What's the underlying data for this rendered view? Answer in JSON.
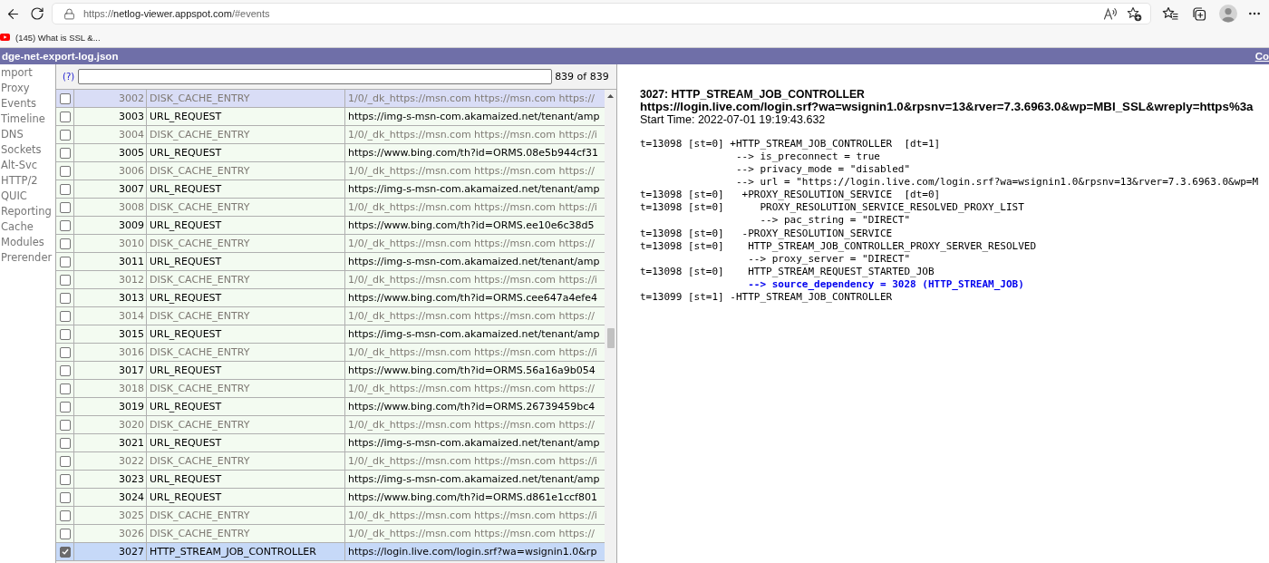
{
  "browser": {
    "url": [
      {
        "text": "https://",
        "kind": "faded"
      },
      {
        "text": "netlog-viewer.appspot.com",
        "kind": "host"
      },
      {
        "text": "/#events",
        "kind": "faded"
      }
    ],
    "bookmarks": [
      {
        "label": "(145) What is SSL &..."
      }
    ]
  },
  "title_bar": {
    "filename": "dge-net-export-log.json",
    "link": "Co"
  },
  "sidebar": {
    "items": [
      {
        "label": "mport"
      },
      {
        "label": "Proxy"
      },
      {
        "label": "Events"
      },
      {
        "label": "Timeline"
      },
      {
        "label": "DNS"
      },
      {
        "label": "Sockets"
      },
      {
        "label": "Alt-Svc"
      },
      {
        "label": "HTTP/2"
      },
      {
        "label": "QUIC"
      },
      {
        "label": "Reporting"
      },
      {
        "label": "Cache"
      },
      {
        "label": "Modules"
      },
      {
        "label": "Prerender"
      }
    ]
  },
  "filter": {
    "help": "(?)",
    "count": "839 of 839"
  },
  "table": {
    "rows": [
      {
        "id": "3002",
        "type": "DISK_CACHE_ENTRY",
        "source": "1/0/_dk_https://msn.com https://msn.com https://",
        "checked": false,
        "selected": false,
        "hovered": true,
        "dimmed": true
      },
      {
        "id": "3003",
        "type": "URL_REQUEST",
        "source": "https://img-s-msn-com.akamaized.net/tenant/amp",
        "checked": false,
        "selected": false,
        "hovered": false,
        "dimmed": false
      },
      {
        "id": "3004",
        "type": "DISK_CACHE_ENTRY",
        "source": "1/0/_dk_https://msn.com https://msn.com https://i",
        "checked": false,
        "selected": false,
        "hovered": false,
        "dimmed": true
      },
      {
        "id": "3005",
        "type": "URL_REQUEST",
        "source": "https://www.bing.com/th?id=ORMS.08e5b944cf31",
        "checked": false,
        "selected": false,
        "hovered": false,
        "dimmed": false
      },
      {
        "id": "3006",
        "type": "DISK_CACHE_ENTRY",
        "source": "1/0/_dk_https://msn.com https://msn.com https://",
        "checked": false,
        "selected": false,
        "hovered": false,
        "dimmed": true
      },
      {
        "id": "3007",
        "type": "URL_REQUEST",
        "source": "https://img-s-msn-com.akamaized.net/tenant/amp",
        "checked": false,
        "selected": false,
        "hovered": false,
        "dimmed": false
      },
      {
        "id": "3008",
        "type": "DISK_CACHE_ENTRY",
        "source": "1/0/_dk_https://msn.com https://msn.com https://i",
        "checked": false,
        "selected": false,
        "hovered": false,
        "dimmed": true
      },
      {
        "id": "3009",
        "type": "URL_REQUEST",
        "source": "https://www.bing.com/th?id=ORMS.ee10e6c38d5",
        "checked": false,
        "selected": false,
        "hovered": false,
        "dimmed": false
      },
      {
        "id": "3010",
        "type": "DISK_CACHE_ENTRY",
        "source": "1/0/_dk_https://msn.com https://msn.com https://",
        "checked": false,
        "selected": false,
        "hovered": false,
        "dimmed": true
      },
      {
        "id": "3011",
        "type": "URL_REQUEST",
        "source": "https://img-s-msn-com.akamaized.net/tenant/amp",
        "checked": false,
        "selected": false,
        "hovered": false,
        "dimmed": false
      },
      {
        "id": "3012",
        "type": "DISK_CACHE_ENTRY",
        "source": "1/0/_dk_https://msn.com https://msn.com https://i",
        "checked": false,
        "selected": false,
        "hovered": false,
        "dimmed": true
      },
      {
        "id": "3013",
        "type": "URL_REQUEST",
        "source": "https://www.bing.com/th?id=ORMS.cee647a4efe4",
        "checked": false,
        "selected": false,
        "hovered": false,
        "dimmed": false
      },
      {
        "id": "3014",
        "type": "DISK_CACHE_ENTRY",
        "source": "1/0/_dk_https://msn.com https://msn.com https://",
        "checked": false,
        "selected": false,
        "hovered": false,
        "dimmed": true
      },
      {
        "id": "3015",
        "type": "URL_REQUEST",
        "source": "https://img-s-msn-com.akamaized.net/tenant/amp",
        "checked": false,
        "selected": false,
        "hovered": false,
        "dimmed": false
      },
      {
        "id": "3016",
        "type": "DISK_CACHE_ENTRY",
        "source": "1/0/_dk_https://msn.com https://msn.com https://i",
        "checked": false,
        "selected": false,
        "hovered": false,
        "dimmed": true
      },
      {
        "id": "3017",
        "type": "URL_REQUEST",
        "source": "https://www.bing.com/th?id=ORMS.56a16a9b054",
        "checked": false,
        "selected": false,
        "hovered": false,
        "dimmed": false
      },
      {
        "id": "3018",
        "type": "DISK_CACHE_ENTRY",
        "source": "1/0/_dk_https://msn.com https://msn.com https://",
        "checked": false,
        "selected": false,
        "hovered": false,
        "dimmed": true
      },
      {
        "id": "3019",
        "type": "URL_REQUEST",
        "source": "https://www.bing.com/th?id=ORMS.26739459bc4",
        "checked": false,
        "selected": false,
        "hovered": false,
        "dimmed": false
      },
      {
        "id": "3020",
        "type": "DISK_CACHE_ENTRY",
        "source": "1/0/_dk_https://msn.com https://msn.com https://",
        "checked": false,
        "selected": false,
        "hovered": false,
        "dimmed": true
      },
      {
        "id": "3021",
        "type": "URL_REQUEST",
        "source": "https://img-s-msn-com.akamaized.net/tenant/amp",
        "checked": false,
        "selected": false,
        "hovered": false,
        "dimmed": false
      },
      {
        "id": "3022",
        "type": "DISK_CACHE_ENTRY",
        "source": "1/0/_dk_https://msn.com https://msn.com https://i",
        "checked": false,
        "selected": false,
        "hovered": false,
        "dimmed": true
      },
      {
        "id": "3023",
        "type": "URL_REQUEST",
        "source": "https://img-s-msn-com.akamaized.net/tenant/amp",
        "checked": false,
        "selected": false,
        "hovered": false,
        "dimmed": false
      },
      {
        "id": "3024",
        "type": "URL_REQUEST",
        "source": "https://www.bing.com/th?id=ORMS.d861e1ccf801",
        "checked": false,
        "selected": false,
        "hovered": false,
        "dimmed": false
      },
      {
        "id": "3025",
        "type": "DISK_CACHE_ENTRY",
        "source": "1/0/_dk_https://msn.com https://msn.com https://i",
        "checked": false,
        "selected": false,
        "hovered": false,
        "dimmed": true
      },
      {
        "id": "3026",
        "type": "DISK_CACHE_ENTRY",
        "source": "1/0/_dk_https://msn.com https://msn.com https://",
        "checked": false,
        "selected": false,
        "hovered": false,
        "dimmed": true
      },
      {
        "id": "3027",
        "type": "HTTP_STREAM_JOB_CONTROLLER",
        "source": "https://login.live.com/login.srf?wa=wsignin1.0&rp",
        "checked": true,
        "selected": true,
        "hovered": false,
        "dimmed": false
      }
    ]
  },
  "details": {
    "title": "3027: HTTP_STREAM_JOB_CONTROLLER",
    "url": "https://login.live.com/login.srf?wa=wsignin1.0&rpsnv=13&rver=7.3.6963.0&wp=MBI_SSL&wreply=https%3a",
    "start_time": "Start Time: 2022-07-01 19:19:43.632",
    "log": [
      {
        "stamp": "t=13098 [st=0]",
        "sign": "+",
        "event": "HTTP_STREAM_JOB_CONTROLLER  [dt=1]",
        "params": [
          {
            "text": "--> is_preconnect = true",
            "kind": "value"
          },
          {
            "text": "--> privacy_mode = \"disabled\"",
            "kind": "value"
          },
          {
            "text": "--> url = \"https://login.live.com/login.srf?wa=wsignin1.0&rpsnv=13&rver=7.3.6963.0&wp=M",
            "kind": "value"
          }
        ],
        "children": [
          {
            "stamp": "t=13098 [st=0]",
            "sign": "+",
            "event": "PROXY_RESOLUTION_SERVICE  [dt=0]",
            "children": [
              {
                "stamp": "t=13098 [st=0]",
                "event": "PROXY_RESOLUTION_SERVICE_RESOLVED_PROXY_LIST",
                "params": [
                  {
                    "text": "--> pac_string = \"DIRECT\"",
                    "kind": "value"
                  }
                ]
              }
            ]
          },
          {
            "stamp": "t=13098 [st=0]",
            "sign": "-",
            "event": "PROXY_RESOLUTION_SERVICE"
          },
          {
            "stamp": "t=13098 [st=0]",
            "event": "HTTP_STREAM_JOB_CONTROLLER_PROXY_SERVER_RESOLVED",
            "params": [
              {
                "text": "--> proxy_server = \"DIRECT\"",
                "kind": "value"
              }
            ]
          },
          {
            "stamp": "t=13098 [st=0]",
            "event": "HTTP_STREAM_REQUEST_STARTED_JOB",
            "params": [
              {
                "text": "--> source_dependency = 3028 (HTTP_STREAM_JOB)",
                "kind": "link"
              }
            ]
          }
        ]
      },
      {
        "stamp": "t=13099 [st=1]",
        "sign": "-",
        "event": "HTTP_STREAM_JOB_CONTROLLER"
      }
    ]
  }
}
